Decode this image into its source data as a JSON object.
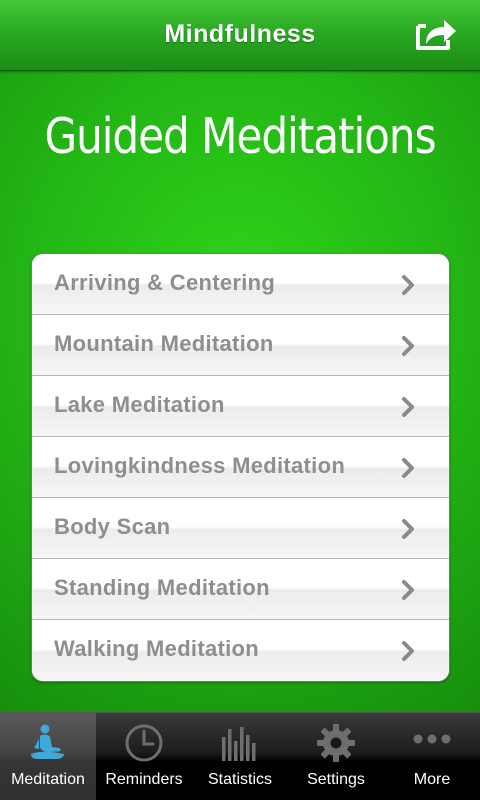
{
  "header": {
    "title": "Mindfulness",
    "share_icon": "share-export-icon"
  },
  "page_title": "Guided Meditations",
  "meditations": [
    {
      "label": "Arriving & Centering"
    },
    {
      "label": "Mountain Meditation"
    },
    {
      "label": "Lake Meditation"
    },
    {
      "label": "Lovingkindness Meditation"
    },
    {
      "label": "Body Scan"
    },
    {
      "label": "Standing Meditation"
    },
    {
      "label": "Walking Meditation"
    }
  ],
  "tabs": [
    {
      "label": "Meditation",
      "icon": "meditating-person-icon",
      "active": true
    },
    {
      "label": "Reminders",
      "icon": "clock-icon",
      "active": false
    },
    {
      "label": "Statistics",
      "icon": "bar-chart-icon",
      "active": false
    },
    {
      "label": "Settings",
      "icon": "gear-icon",
      "active": false
    },
    {
      "label": "More",
      "icon": "more-dots-icon",
      "active": false
    }
  ],
  "colors": {
    "background_green": "#23b515",
    "header_green": "#2aa922",
    "item_text": "#8e8e8e",
    "active_icon": "#3fa9d8",
    "inactive_icon": "#6e6e6e"
  }
}
